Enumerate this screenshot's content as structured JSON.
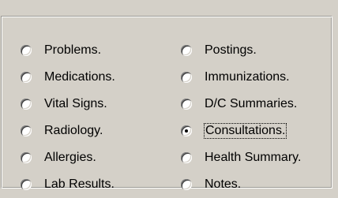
{
  "record_types": {
    "left_column": [
      {
        "label": "Problems.",
        "checked": false
      },
      {
        "label": "Medications.",
        "checked": false
      },
      {
        "label": "Vital Signs.",
        "checked": false
      },
      {
        "label": "Radiology.",
        "checked": false
      },
      {
        "label": "Allergies.",
        "checked": false
      },
      {
        "label": "Lab Results.",
        "checked": false
      }
    ],
    "right_column": [
      {
        "label": "Postings.",
        "checked": false
      },
      {
        "label": "Immunizations.",
        "checked": false
      },
      {
        "label": "D/C Summaries.",
        "checked": false
      },
      {
        "label": "Consultations.",
        "checked": true
      },
      {
        "label": "Health Summary.",
        "checked": false
      },
      {
        "label": "Notes.",
        "checked": false
      }
    ]
  },
  "colors": {
    "background": "#d4d0c8",
    "text": "#000000",
    "radio_fill": "#ffffff"
  }
}
